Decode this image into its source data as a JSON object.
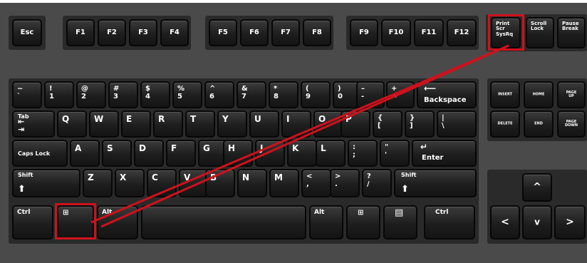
{
  "colors": {
    "keyboard": "#4a4a4a",
    "key": "#1e1e1e",
    "highlight": "#d0111b"
  },
  "keys": {
    "esc": "Esc",
    "f1": "F1",
    "f2": "F2",
    "f3": "F3",
    "f4": "F4",
    "f5": "F5",
    "f6": "F6",
    "f7": "F7",
    "f8": "F8",
    "f9": "F9",
    "f10": "F10",
    "f11": "F11",
    "f12": "F12",
    "print_screen": "Print\nScr\nSysRq",
    "scroll_lock": "Scroll\nLock",
    "pause": "Pause\nBreak",
    "tilde": "~\n`",
    "n1": "!\n1",
    "n2": "@\n2",
    "n3": "#\n3",
    "n4": "$\n4",
    "n5": "%\n5",
    "n6": "^\n6",
    "n7": "&\n7",
    "n8": "*\n8",
    "n9": "(\n9",
    "n0": ")\n0",
    "minus": "–\n-",
    "equals": "+\n=",
    "backspace": "Backspace",
    "tab": "Tab",
    "q": "Q",
    "w": "W",
    "e": "E",
    "r": "R",
    "t": "T",
    "y": "Y",
    "u": "U",
    "i": "I",
    "o": "O",
    "p": "P",
    "lbracket": "{\n[",
    "rbracket": "}\n]",
    "backslash": "|\n\\",
    "caps_lock": "Caps Lock",
    "a": "A",
    "s": "S",
    "d": "D",
    "f": "F",
    "g": "G",
    "h": "H",
    "j": "J",
    "k": "K",
    "l": "L",
    "semicolon": ":\n;",
    "quote": "\"\n'",
    "enter": "Enter",
    "shift_left": "Shift",
    "z": "Z",
    "x": "X",
    "c": "C",
    "v": "V",
    "b": "B",
    "n": "N",
    "m": "M",
    "comma": "<\n,",
    "period": ">\n.",
    "slash": "?\n/",
    "shift_right": "Shift",
    "ctrl_left": "Ctrl",
    "alt_left": "Alt",
    "alt_right": "Alt",
    "ctrl_right": "Ctrl",
    "insert": "INSERT",
    "home": "HOME",
    "page_up": "PAGE\nUP",
    "delete": "DELETE",
    "end": "END",
    "page_down": "PAGE\nDOWN"
  }
}
